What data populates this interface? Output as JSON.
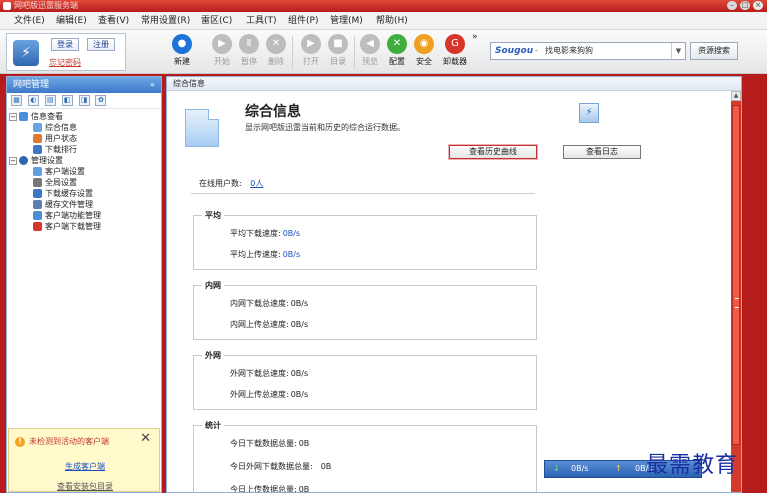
{
  "window": {
    "title": "网吧版迅雷服务端",
    "buttons": [
      "–",
      "□",
      "×"
    ]
  },
  "menu": [
    "文件(E)",
    "编辑(E)",
    "查看(V)",
    "常用设置(R)",
    "雷区(C)",
    "工具(T)",
    "组件(P)",
    "管理(M)",
    "帮助(H)"
  ],
  "login": {
    "login_label": "登录",
    "register_label": "注册",
    "forgot_label": "忘记密码"
  },
  "toolbar": {
    "items": [
      {
        "label": "新建",
        "symbol": "●",
        "color": "#1e73d8"
      },
      {
        "label": "开始",
        "symbol": "▶",
        "color": "#bdbdbd"
      },
      {
        "label": "暂停",
        "symbol": "Ⅱ",
        "color": "#bdbdbd"
      },
      {
        "label": "删除",
        "symbol": "✕",
        "color": "#bdbdbd"
      },
      {
        "label": "打开",
        "symbol": "▶",
        "color": "#bdbdbd"
      },
      {
        "label": "目录",
        "symbol": "■",
        "color": "#bdbdbd"
      },
      {
        "label": "预览",
        "symbol": "◀",
        "color": "#bdbdbd"
      },
      {
        "label": "配置",
        "symbol": "✕",
        "color": "#3fae3f"
      },
      {
        "label": "安全",
        "symbol": "◉",
        "color": "#f0a020"
      },
      {
        "label": "卸载器",
        "symbol": "G",
        "color": "#d9342a"
      }
    ],
    "more_symbol": "»"
  },
  "search": {
    "brand": "Sougou",
    "separator": "-",
    "value": "找电影来狗狗",
    "button_label": "资源搜索"
  },
  "sidebar": {
    "title": "网吧管理",
    "collapse_symbol": "«",
    "icons": [
      "▦",
      "◐",
      "▤",
      "◧",
      "◨",
      "✿"
    ],
    "tree": [
      {
        "label": "信息查看",
        "level": 0,
        "expander": "−",
        "icon_color": "#4a8fd8"
      },
      {
        "label": "综合信息",
        "level": 1,
        "icon_color": "#6aa3df"
      },
      {
        "label": "用户状态",
        "level": 1,
        "icon_color": "#e07a30"
      },
      {
        "label": "下载排行",
        "level": 1,
        "icon_color": "#3b78c8"
      },
      {
        "label": "管理设置",
        "level": 0,
        "expander": "−",
        "icon_color": "#2e67b0"
      },
      {
        "label": "客户端设置",
        "level": 1,
        "icon_color": "#5ea0e0"
      },
      {
        "label": "全局设置",
        "level": 1,
        "icon_color": "#777777"
      },
      {
        "label": "下载缓存设置",
        "level": 1,
        "icon_color": "#3b78c8"
      },
      {
        "label": "缓存文件管理",
        "level": 1,
        "icon_color": "#5a7fb0"
      },
      {
        "label": "客户端功能管理",
        "level": 1,
        "icon_color": "#4a8fd8"
      },
      {
        "label": "客户端下载管理",
        "level": 1,
        "icon_color": "#d9342a"
      }
    ]
  },
  "notice": {
    "message": "未检测到活动的客户端",
    "close_symbol": "✕",
    "generate_label": "生成客户端",
    "view_label": "查看安装包目录"
  },
  "main": {
    "tab": "综合信息",
    "title": "综合信息",
    "description": "显示网吧版迅雷当前和历史的综合运行数据。",
    "history_button": "查看历史曲线",
    "log_button": "查看日志",
    "online_label": "在线用户数:",
    "online_count": "0人",
    "groups": [
      {
        "title": "平均",
        "rows": [
          {
            "label": "平均下载速度:",
            "value": "0B/s",
            "link": true
          },
          {
            "label": "平均上传速度:",
            "value": "0B/s",
            "link": true
          }
        ]
      },
      {
        "title": "内网",
        "rows": [
          {
            "label": "内网下载总速度:",
            "value": "0B/s",
            "link": false
          },
          {
            "label": "内网上传总速度:",
            "value": "0B/s",
            "link": false
          }
        ]
      },
      {
        "title": "外网",
        "rows": [
          {
            "label": "外网下载总速度:",
            "value": "0B/s",
            "link": false
          },
          {
            "label": "外网上传总速度:",
            "value": "0B/s",
            "link": false
          }
        ]
      },
      {
        "title": "统计",
        "rows": [
          {
            "label": "今日下载数据总量:",
            "value": "0B",
            "link": false
          },
          {
            "label": "今日外网下载数据总量:",
            "value": "0B",
            "link": false
          },
          {
            "label": "今日上传数据总量:",
            "value": "0B",
            "link": false
          }
        ]
      }
    ]
  },
  "speedbar": {
    "down_arrow": "↓",
    "down_value": "0B/s",
    "up_arrow": "↑",
    "up_value": "0B/s"
  },
  "watermark": "最需教育",
  "colors": {
    "frame": "#b71c1c",
    "scrollbar": "#d43a2a",
    "link": "#1a4fc4",
    "accent_blue": "#3b78c8"
  }
}
